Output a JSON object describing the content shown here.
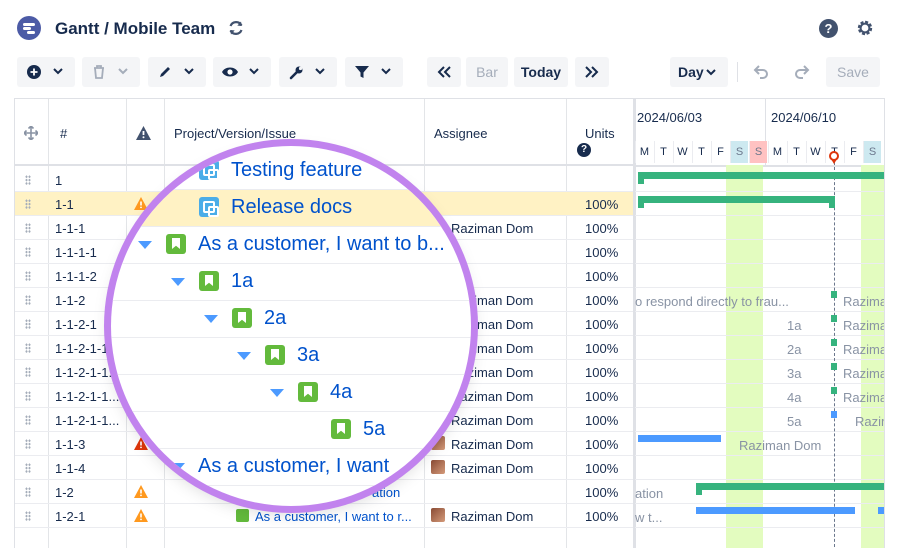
{
  "header": {
    "title": "Gantt / Mobile Team",
    "help_label": "?"
  },
  "toolbar": {
    "bar_label": "Bar",
    "today_label": "Today",
    "scale_label": "Day",
    "save_label": "Save"
  },
  "grid": {
    "columns": [
      "#",
      "Project/Version/Issue",
      "Assignee",
      "Units"
    ],
    "rows": [
      {
        "num": "1",
        "warn": "",
        "assignee": "",
        "units": ""
      },
      {
        "num": "1-1",
        "warn": "orange",
        "assignee": "",
        "units": "100%"
      },
      {
        "num": "1-1-1",
        "warn": "",
        "assignee": "Raziman Dom",
        "units": "100%"
      },
      {
        "num": "1-1-1-1",
        "warn": "",
        "assignee": "",
        "units": "100%"
      },
      {
        "num": "1-1-1-2",
        "warn": "",
        "assignee": "",
        "units": "100%"
      },
      {
        "num": "1-1-2",
        "warn": "",
        "assignee": "Raziman Dom",
        "units": "100%"
      },
      {
        "num": "1-1-2-1",
        "warn": "",
        "assignee": "Raziman Dom",
        "units": "100%"
      },
      {
        "num": "1-1-2-1-1",
        "warn": "",
        "assignee": "Raziman Dom",
        "units": "100%"
      },
      {
        "num": "1-1-2-1-1...",
        "warn": "",
        "assignee": "Raziman Dom",
        "units": "100%"
      },
      {
        "num": "1-1-2-1-1...",
        "warn": "",
        "assignee": "Raziman Dom",
        "units": "100%"
      },
      {
        "num": "1-1-2-1-1...",
        "warn": "",
        "assignee": "Raziman Dom",
        "units": "100%"
      },
      {
        "num": "1-1-3",
        "warn": "red",
        "assignee": "Raziman Dom",
        "units": "100%"
      },
      {
        "num": "1-1-4",
        "warn": "",
        "assignee": "Raziman Dom",
        "units": "100%"
      },
      {
        "num": "1-2",
        "warn": "orange",
        "assignee": "",
        "units": "100%",
        "title": "ation"
      },
      {
        "num": "1-2-1",
        "warn": "orange",
        "assignee": "Raziman Dom",
        "units": "100%",
        "title": "As a customer, I want to r..."
      }
    ]
  },
  "gantt": {
    "weeks": [
      "2024/06/03",
      "2024/06/10"
    ],
    "days": [
      "M",
      "T",
      "W",
      "T",
      "F",
      "S",
      "S",
      "M",
      "T",
      "W",
      "T",
      "F",
      "S"
    ],
    "labels": {
      "row_1_1_2": "o respond directly to frau...",
      "raziman": "Razima",
      "l1a": "1a",
      "l2a": "2a",
      "l3a": "3a",
      "l4a": "4a",
      "l5a": "5a",
      "raziman_dom": "Raziman Dom",
      "ation": "ation",
      "w": "w t..."
    }
  },
  "magnifier": {
    "rows": [
      {
        "text": "Testing feature"
      },
      {
        "text": "Release docs"
      },
      {
        "text": "As a customer, I want to b..."
      },
      {
        "text": "1a"
      },
      {
        "text": "2a"
      },
      {
        "text": "3a"
      },
      {
        "text": "4a"
      },
      {
        "text": "5a"
      },
      {
        "text": "As a customer, I want"
      }
    ]
  }
}
